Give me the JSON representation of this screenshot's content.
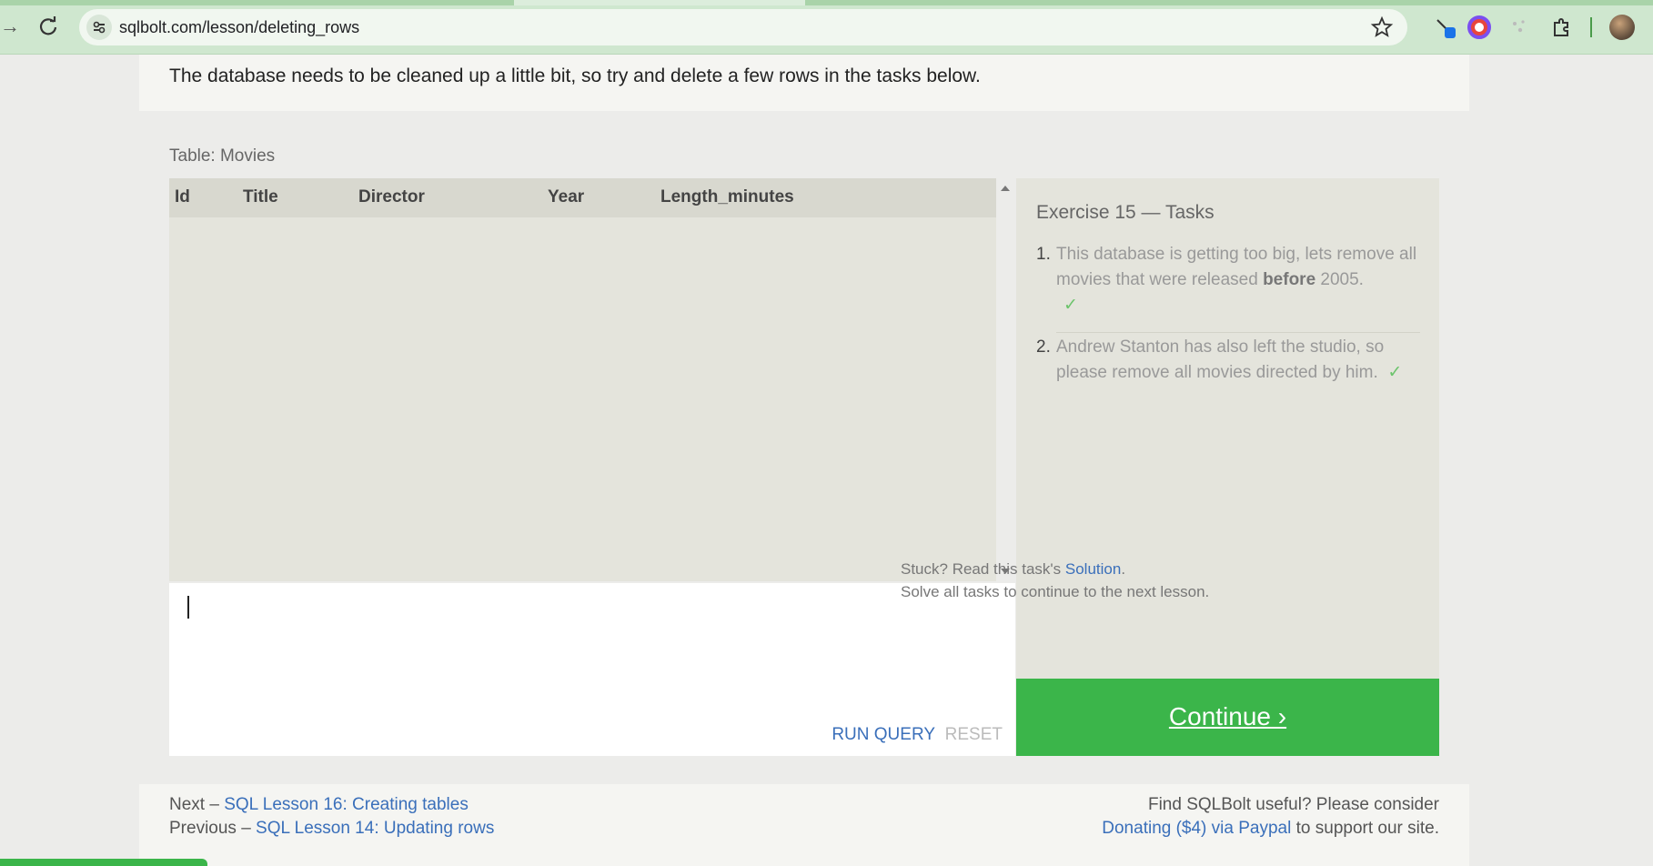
{
  "browser": {
    "url": "sqlbolt.com/lesson/deleting_rows",
    "icons": [
      "forward-icon",
      "reload-icon",
      "site-info-icon",
      "bookmark-star-icon",
      "extension-pen-icon",
      "extension-color-icon",
      "extension-sparkle-icon",
      "extensions-puzzle-icon",
      "profile-avatar"
    ]
  },
  "intro": {
    "text": "The database needs to be cleaned up a little bit, so try and delete a few rows in the tasks below."
  },
  "table": {
    "caption": "Table: Movies",
    "columns": [
      "Id",
      "Title",
      "Director",
      "Year",
      "Length_minutes"
    ],
    "rows": []
  },
  "editor": {
    "value": "",
    "run_label": "RUN QUERY",
    "reset_label": "RESET"
  },
  "tasks": {
    "title": "Exercise 15 — Tasks",
    "items": [
      {
        "num": "1.",
        "text_before": "This database is getting too big, lets remove all movies that were released ",
        "text_bold": "before",
        "text_after": " 2005.",
        "check": "✓"
      },
      {
        "num": "2.",
        "text": "Andrew Stanton has also left the studio, so please remove all movies directed by him.",
        "check": "✓"
      }
    ],
    "stuck_text": "Stuck? Read this task's ",
    "solution_link": "Solution",
    "stuck_end": ".",
    "solve_text": "Solve all tasks to continue to the next lesson.",
    "continue_label": "Continue ›"
  },
  "footer": {
    "next_prefix": "Next – ",
    "next_link": "SQL Lesson 16: Creating tables",
    "prev_prefix": "Previous – ",
    "prev_link": "SQL Lesson 14: Updating rows",
    "support_text": "Find SQLBolt useful? Please consider",
    "donate_link": "Donating ($4) via Paypal",
    "support_end": " to support our site."
  },
  "colors": {
    "accent_green": "#3bb54a",
    "link_blue": "#3a6fba",
    "check_green": "#6cc46c",
    "chrome_green": "#cfe7cf"
  }
}
